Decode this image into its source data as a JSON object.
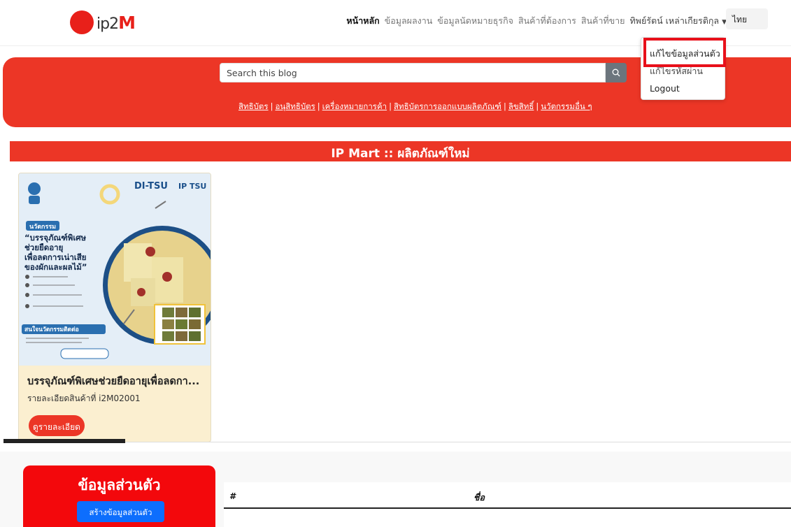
{
  "brand": {
    "name": "ip2",
    "accent": "M",
    "color": "#e8201a"
  },
  "nav": {
    "items": [
      "หน้าหลัก",
      "ข้อมูลผลงาน",
      "ข้อมูลนัดหมายธุรกิจ",
      "สินค้าที่ต้องการ",
      "สินค้าที่ขาย"
    ],
    "user": "ทิพย์รัตน์ เหล่าเกียรติกุล",
    "language": "ไทย"
  },
  "dropdown": {
    "items": [
      "แก้ไขข้อมูลส่วนตัว",
      "แก้ไขรหัสผ่าน",
      "Logout"
    ]
  },
  "search": {
    "placeholder": "Search this blog"
  },
  "categories": [
    "สิทธิบัตร",
    "อนุสิทธิบัตร",
    "เครื่องหมายการค้า",
    "สิทธิบัตรการออกแบบผลิตภัณฑ์",
    "ลิขสิทธิ์",
    "นวัตกรรมอื่น ๆ"
  ],
  "mart": {
    "title": "IP Mart :: ผลิตภัณฑ์ใหม่"
  },
  "product": {
    "poster": {
      "logo1": "DI-TSU",
      "logo2": "IP TSU",
      "tag": "นวัตกรรม",
      "headline": [
        "“บรรจุภัณฑ์พิเศษ",
        "ช่วยยืดอายุ",
        "เพื่อลดการเน่าเสีย",
        "ของผักและผลไม้”"
      ],
      "interest": "สนใจนวัตกรรมติดต่อ"
    },
    "title": "บรรจุภัณฑ์พิเศษช่วยยืดอายุเพื่อลดกา...",
    "code_label": "รายละเอียดสินค้าที่ i2M02001",
    "details_button": "ดูรายละเอียด"
  },
  "profile": {
    "title": "ข้อมูลส่วนตัว",
    "create_button": "สร้างข้อมูลส่วนตัว"
  },
  "table": {
    "headers": [
      "#",
      "ชื่อ"
    ]
  }
}
